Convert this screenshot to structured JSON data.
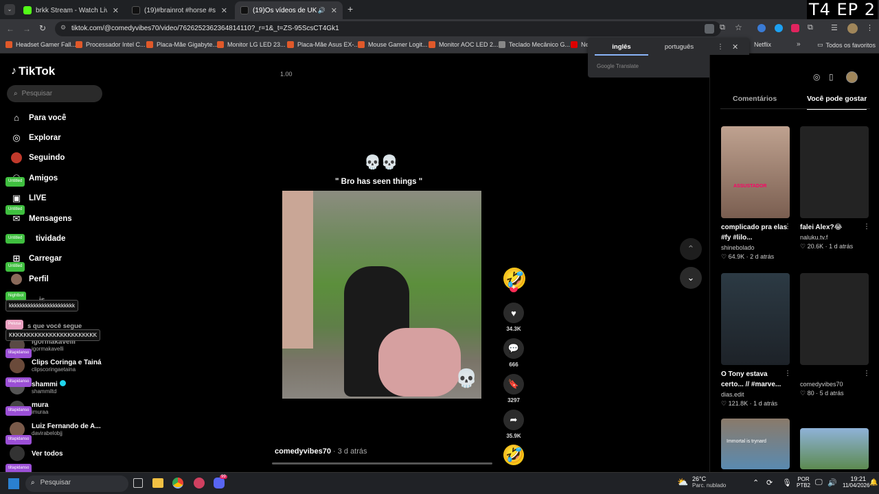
{
  "overlay": {
    "episode": "T4 EP 2"
  },
  "tabs": [
    {
      "title": "brkk Stream - Watch Live o",
      "color": "#53fc18"
    },
    {
      "title": "(19)#brainrot #horse #scream",
      "color": "#111111"
    },
    {
      "title": "(19)Os vídeos de UK op (@",
      "color": "#111111"
    }
  ],
  "address": {
    "url": "tiktok.com/@comedyvibes70/video/7626252362364814110?_r=1&_t=ZS-95ScsCT4Gk1"
  },
  "bookmarks": [
    "Headset Gamer Fall...",
    "Processador Intel C...",
    "Placa-Mãe Gigabyte...",
    "Monitor LG LED 23...",
    "Placa-Mãe Asus EX-...",
    "Mouse Gamer Logit...",
    "Monitor AOC LED 2...",
    "Teclado Mecânico G...",
    "Ne",
    "Netflix",
    "Todos os favoritos"
  ],
  "translate": {
    "tab_source": "inglês",
    "tab_target": "português",
    "brand": "Google Translate"
  },
  "sidebar": {
    "logo": "TikTok",
    "search_placeholder": "Pesquisar",
    "nav": [
      {
        "label": "Para você",
        "icon": "home-icon"
      },
      {
        "label": "Explorar",
        "icon": "compass-icon"
      },
      {
        "label": "Seguindo",
        "icon": "following-icon"
      },
      {
        "label": "Amigos",
        "icon": "friends-icon"
      },
      {
        "label": "LIVE",
        "icon": "live-icon"
      },
      {
        "label": "Mensagens",
        "icon": "messages-icon"
      },
      {
        "label": "tividade",
        "icon": "activity-icon"
      },
      {
        "label": "Carregar",
        "icon": "upload-icon"
      },
      {
        "label": "Perfil",
        "icon": "profile-icon"
      },
      {
        "label": "is",
        "icon": "more-icon"
      }
    ],
    "following_title": "s que você segue",
    "following": [
      {
        "name": "igormakavelli",
        "handle": "igormakavelli"
      },
      {
        "name": "Clips Coringa e Tainá",
        "handle": "clipscoringaetaina"
      },
      {
        "name": "shammi",
        "handle": "shammiltd"
      },
      {
        "name": "mura",
        "handle": "imuraa"
      },
      {
        "name": "Luiz Fernando de A...",
        "handle": "davirabelobjj"
      }
    ],
    "see_all": "Ver todos"
  },
  "stream_overlay": {
    "badges": [
      "Untitled",
      "Untitled",
      "Untitled",
      "Untitled",
      "Nightbot",
      "Pelusa",
      "tiltapidanso",
      "tiltapidanso",
      "tiltapidanso",
      "tiltapidanso",
      "tiltapidanso"
    ],
    "chat": [
      "kkkkkkkkkkkkkkkkkkkkkkkk",
      "KKKKKKKKKKKKKKKKKKKKKKKK"
    ]
  },
  "player": {
    "speed": "1.00",
    "emoji_caption": "💀💀",
    "caption": "\" Bro has seen things \"",
    "author": "comedyvibes70",
    "age": "· 3 d atrás",
    "likes": "34.3K",
    "comments": "666",
    "saves": "3297",
    "shares": "35.9K"
  },
  "right_panel": {
    "tab_comments": "Comentários",
    "tab_recommended": "Você pode gostar",
    "cards": [
      {
        "title": "complicado pra elas #fy #lilo...",
        "author": "shinebolado",
        "likes": "64.9K",
        "age": "2 d atrás",
        "color": "#8a7a70",
        "overlay": "ASSUSTADOR"
      },
      {
        "title": "falei Alex?😂",
        "author": "naluku.tv.f",
        "likes": "20.6K",
        "age": "1 d atrás",
        "color": "#222222",
        "overlay": ""
      },
      {
        "title": "O Tony estava certo... // #marve...",
        "author": "dias.edit",
        "likes": "121.8K",
        "age": "1 d atrás",
        "color": "#2f3a40",
        "overlay": ""
      },
      {
        "title": "",
        "author": "comedyvibes70",
        "likes": "80",
        "age": "5 d atrás",
        "color": "#222222",
        "overlay": ""
      },
      {
        "title": "",
        "author": "",
        "likes": "",
        "age": "",
        "color": "#7a6a5a",
        "overlay": "Immortal is trynard"
      },
      {
        "title": "",
        "author": "",
        "likes": "",
        "age": "",
        "color": "#6a8a6a",
        "overlay": ""
      }
    ]
  },
  "taskbar": {
    "search": "Pesquisar",
    "weather_temp": "26°C",
    "weather_desc": "Parc. nublado",
    "lang": "POR",
    "layout": "PTB2",
    "time": "19:21",
    "date": "11/04/2026",
    "discord_badge": "99"
  }
}
